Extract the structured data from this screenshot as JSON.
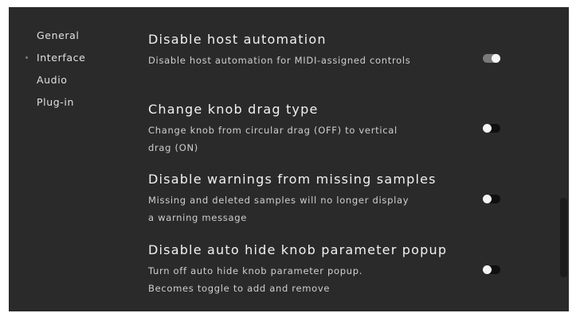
{
  "sidebar": {
    "items": [
      {
        "label": "General",
        "active": false
      },
      {
        "label": "Interface",
        "active": true
      },
      {
        "label": "Audio",
        "active": false
      },
      {
        "label": "Plug-in",
        "active": false
      }
    ]
  },
  "settings": [
    {
      "title": "Disable host automation",
      "description": "Disable host automation for MIDI-assigned controls",
      "enabled": true
    },
    {
      "title": "Change knob drag type",
      "description": "Change knob from circular drag (OFF) to vertical drag (ON)",
      "enabled": false
    },
    {
      "title": "Disable warnings from missing samples",
      "description": "Missing and deleted samples will no longer display a warning message",
      "enabled": false
    },
    {
      "title": "Disable auto hide knob parameter popup",
      "description": "Turn off auto hide knob parameter popup. Becomes toggle to add and remove",
      "enabled": false
    }
  ],
  "colors": {
    "background": "#2a2a2a",
    "toggle_on": "#7a7a7a",
    "toggle_off": "#0f0f0f",
    "knob": "#f5f5f5"
  }
}
